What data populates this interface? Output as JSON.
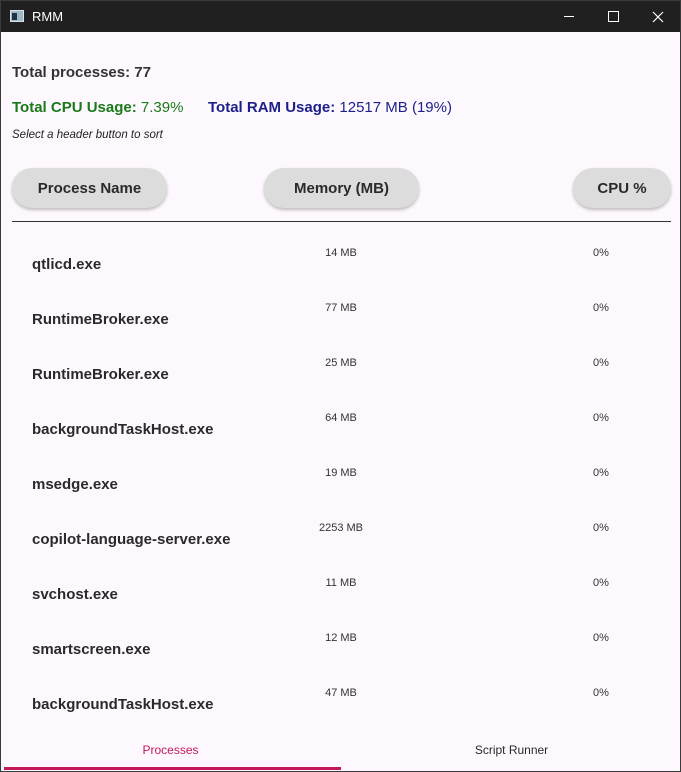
{
  "window": {
    "title": "RMM"
  },
  "summary": {
    "total_processes": "Total processes: 77",
    "cpu_label": "Total CPU Usage:",
    "cpu_value": " 7.39%",
    "ram_label": "Total RAM Usage:",
    "ram_value": " 12517 MB (19%)",
    "hint": "Select a header button to sort"
  },
  "headers": {
    "process_name": "Process Name",
    "memory": "Memory (MB)",
    "cpu": "CPU %"
  },
  "processes": [
    {
      "name": "qtlicd.exe",
      "memory": "14 MB",
      "cpu": "0%"
    },
    {
      "name": "RuntimeBroker.exe",
      "memory": "77 MB",
      "cpu": "0%"
    },
    {
      "name": "RuntimeBroker.exe",
      "memory": "25 MB",
      "cpu": "0%"
    },
    {
      "name": "backgroundTaskHost.exe",
      "memory": "64 MB",
      "cpu": "0%"
    },
    {
      "name": "msedge.exe",
      "memory": "19 MB",
      "cpu": "0%"
    },
    {
      "name": "copilot-language-server.exe",
      "memory": "2253 MB",
      "cpu": "0%"
    },
    {
      "name": "svchost.exe",
      "memory": "11 MB",
      "cpu": "0%"
    },
    {
      "name": "smartscreen.exe",
      "memory": "12 MB",
      "cpu": "0%"
    },
    {
      "name": "backgroundTaskHost.exe",
      "memory": "47 MB",
      "cpu": "0%"
    }
  ],
  "tabs": {
    "processes": "Processes",
    "script_runner": "Script Runner",
    "active": "processes"
  },
  "colors": {
    "cpu": "#1a7a1a",
    "ram": "#1d1f8a",
    "accent": "#c2185b"
  }
}
